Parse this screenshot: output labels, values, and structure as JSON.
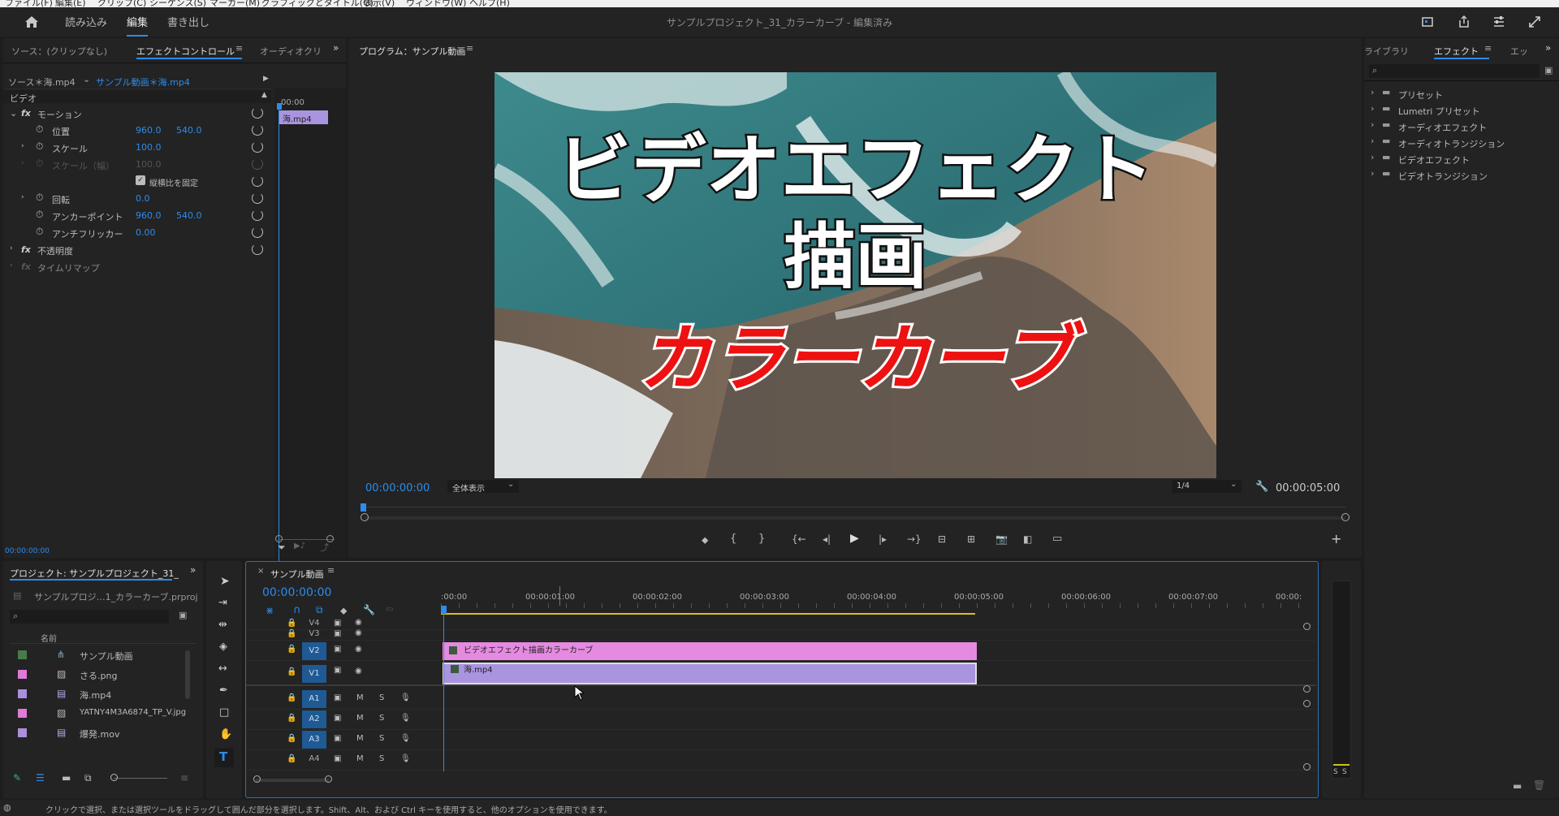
{
  "menu": [
    "ファイル(F)",
    "編集(E)",
    "クリップ(C)",
    "シーケンス(S)",
    "マーカー(M)",
    "グラフィックとタイトル(G)",
    "表示(V)",
    "ウィンドウ(W)",
    "ヘルプ(H)"
  ],
  "workspaces": {
    "import": "読み込み",
    "edit": "編集",
    "export": "書き出し"
  },
  "window_title": "サンプルプロジェクト_31_カラーカーブ - 編集済み",
  "effect_controls": {
    "tab_source": "ソース：(クリップなし)",
    "tab_effect": "エフェクトコントロール",
    "tab_audio": "オーディオクリ",
    "source_master": "ソース＊海.mp4",
    "source_clip": "サンプル動画＊海.mp4",
    "timecode_top": "00:00",
    "mini_clip": "海.mp4",
    "video_header": "ビデオ",
    "motion": "モーション",
    "position_label": "位置",
    "position_x": "960.0",
    "position_y": "540.0",
    "scale_label": "スケール",
    "scale_value": "100.0",
    "scale_w_label": "スケール（幅）",
    "scale_w_value": "100.0",
    "uniform_label": "縦横比を固定",
    "rotation_label": "回転",
    "rotation_value": "0.0",
    "anchor_label": "アンカーポイント",
    "anchor_x": "960.0",
    "anchor_y": "540.0",
    "flicker_label": "アンチフリッカー",
    "flicker_value": "0.00",
    "opacity_label": "不透明度",
    "timeremap_label": "タイムリマップ",
    "bottom_timecode": "00:00:00:00"
  },
  "program": {
    "title": "プログラム：サンプル動画",
    "overlay_line1": "ビデオエフェクト",
    "overlay_line2": "描画",
    "overlay_line3": "カラーカーブ",
    "timecode": "00:00:00:00",
    "fit": "全体表示",
    "resolution": "1/4",
    "duration": "00:00:05:00"
  },
  "effects_panel": {
    "tab_library": "ライブラリ",
    "tab_effects": "エフェクト",
    "tab_more": "エッ",
    "items": [
      "プリセット",
      "Lumetri プリセット",
      "オーディオエフェクト",
      "オーディオトランジション",
      "ビデオエフェクト",
      "ビデオトランジション"
    ]
  },
  "project": {
    "tab": "プロジェクト: サンプルプロジェクト_31_",
    "file": "サンプルプロジ…1_カラーカーブ.prproj",
    "column_name": "名前",
    "items": [
      {
        "name": "サンプル動画",
        "color": "#4a7a4a"
      },
      {
        "name": "さる.png",
        "color": "#e07ad8"
      },
      {
        "name": "海.mp4",
        "color": "#a98fdc"
      },
      {
        "name": "YATNY4M3A6874_TP_V.jpg",
        "color": "#e07ad8"
      },
      {
        "name": "爆発.mov",
        "color": "#a98fdc"
      }
    ]
  },
  "timeline": {
    "tab": "サンプル動画",
    "timecode": "00:00:00:00",
    "ruler": [
      ":00:00",
      "00:00:01:00",
      "00:00:02:00",
      "00:00:03:00",
      "00:00:04:00",
      "00:00:05:00",
      "00:00:06:00",
      "00:00:07:00",
      "00:00:"
    ],
    "video_tracks": [
      "V4",
      "V3",
      "V2",
      "V1"
    ],
    "audio_tracks": [
      "A1",
      "A2",
      "A3",
      "A4"
    ],
    "mute": "M",
    "solo": "S",
    "clip_v2": "ビデオエフェクト描画カラーカーブ",
    "clip_v1": "海.mp4"
  },
  "audio_meter": {
    "s1": "S",
    "s2": "S"
  },
  "status_bar": "クリックで選択、または選択ツールをドラッグして囲んだ部分を選択します。Shift、Alt、および Ctrl キーを使用すると、他のオプションを使用できます。",
  "colors": {
    "accent": "#2d8ceb",
    "clip_v2": "#e58ae0",
    "clip_v1": "#a994e0"
  }
}
